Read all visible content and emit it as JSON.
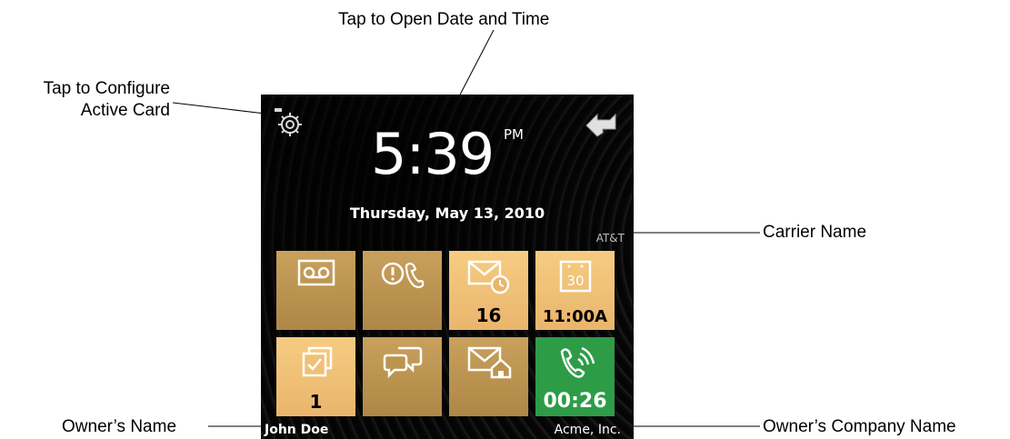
{
  "callouts": {
    "date_time": "Tap to Open Date and Time",
    "configure_line1": "Tap to Configure",
    "configure_line2": "Active Card",
    "carrier": "Carrier Name",
    "owner": "Owner’s Name",
    "company": "Owner’s Company Name"
  },
  "screen": {
    "time": "5:39",
    "ampm": "PM",
    "date": "Thursday, May 13, 2010",
    "carrier": "AT&T",
    "owner_name": "John Doe",
    "company_name": "Acme, Inc."
  },
  "tiles": [
    {
      "name": "voicemail",
      "icon": "voicemail-icon",
      "count": ""
    },
    {
      "name": "missed-calls",
      "icon": "missed-call-icon",
      "count": ""
    },
    {
      "name": "email",
      "icon": "mail-clock-icon",
      "count": "16"
    },
    {
      "name": "calendar",
      "icon": "calendar-icon",
      "count": "11:00A"
    },
    {
      "name": "tasks",
      "icon": "tasks-icon",
      "count": "1"
    },
    {
      "name": "messaging",
      "icon": "chat-icon",
      "count": ""
    },
    {
      "name": "home-mail",
      "icon": "mail-home-icon",
      "count": ""
    },
    {
      "name": "active-call",
      "icon": "phone-ringing-icon",
      "count": "00:26"
    }
  ],
  "calendar_day": "30",
  "colors": {
    "tile_bright": "#f0c274",
    "tile_dim": "#bb9450",
    "tile_call": "#2e9c47",
    "background": "#050505"
  }
}
